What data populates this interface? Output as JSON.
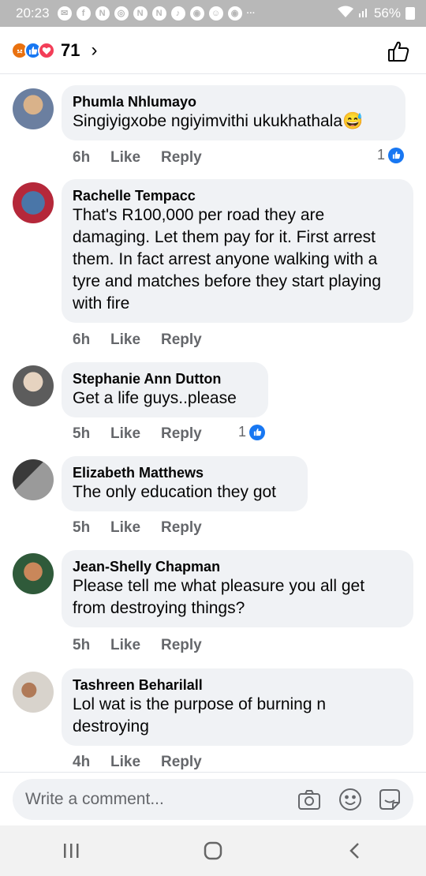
{
  "status_bar": {
    "time": "20:23",
    "battery": "56%",
    "more": "···"
  },
  "header": {
    "reaction_count": "71",
    "chevron": "›"
  },
  "comments": [
    {
      "author": "Phumla Nhlumayo",
      "text": "Singiyigxobe ngiyimvithi ukukhathala😅",
      "time": "6h",
      "like": "Like",
      "reply": "Reply",
      "likes": "1"
    },
    {
      "author": "Rachelle Tempacc",
      "text": "That's R100,000 per road they are damaging. Let them pay for it. First arrest them. In fact arrest anyone walking with a tyre and matches before they start playing with fire",
      "time": "6h",
      "like": "Like",
      "reply": "Reply"
    },
    {
      "author": "Stephanie Ann Dutton",
      "text": "Get a life guys..please",
      "time": "5h",
      "like": "Like",
      "reply": "Reply",
      "likes": "1"
    },
    {
      "author": "Elizabeth Matthews",
      "text": "The only education they got",
      "time": "5h",
      "like": "Like",
      "reply": "Reply"
    },
    {
      "author": "Jean-Shelly Chapman",
      "text": "Please tell me what pleasure you all get from destroying things?",
      "time": "5h",
      "like": "Like",
      "reply": "Reply"
    },
    {
      "author": "Tashreen Beharilall",
      "text": "Lol wat is the purpose of burning n destroying",
      "time": "4h",
      "like": "Like",
      "reply": "Reply"
    }
  ],
  "composer": {
    "placeholder": "Write a comment..."
  },
  "icons": {
    "reactions": [
      "angry-reaction-icon",
      "like-reaction-icon",
      "love-reaction-icon"
    ],
    "header_action": "thumbs-up-icon",
    "composer": [
      "camera-icon",
      "emoji-icon",
      "sticker-icon"
    ],
    "nav": [
      "recents-icon",
      "home-icon",
      "back-icon"
    ]
  },
  "colors": {
    "accent": "#1877f2",
    "bubble": "#f0f2f5",
    "meta_text": "#65676b",
    "status_bar": "#b8b8b8"
  }
}
